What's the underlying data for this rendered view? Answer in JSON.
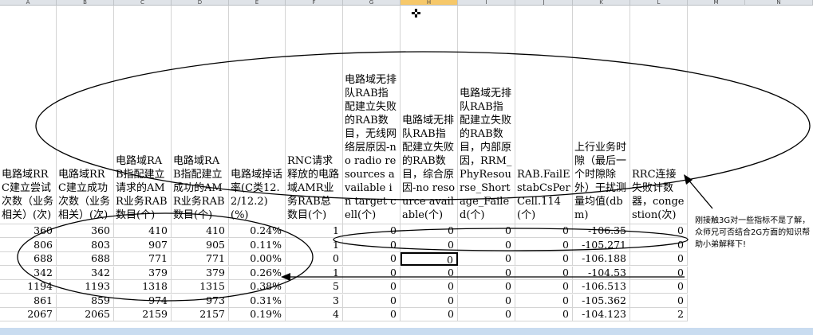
{
  "columns": [
    "A",
    "B",
    "C",
    "D",
    "E",
    "F",
    "G",
    "H",
    "I",
    "J",
    "K",
    "L",
    "M",
    "N"
  ],
  "selected_column": "H",
  "headers": [
    "电路域RRC建立尝试次数（业务相关）(次)",
    "电路域RRC建立成功次数（业务相关）(次)",
    "电路域RAB指配建立请求的AMR业务RAB数目(个)",
    "电路域RAB指配建立成功的AMR业务RAB数目(个)",
    "电路域掉话率(C类12.2/12.2)(%)",
    "RNC请求释放的电路域AMR业务RAB总数目(个)",
    "电路域无排队RAB指配建立失败的RAB数目，无线网络层原因-no radio resources available in target cell(个)",
    "电路域无排队RAB指配建立失败的RAB数目，综合原因-no resource available(个)",
    "电路域无排队RAB指配建立失败的RAB数目，内部原因，RRM_PhyResourse_Shortage_Failed(个)",
    "RAB.FailEstabCsPerCell.114(个)",
    "上行业务时隙（最后一个时隙除外）干扰测量均值(dbm)",
    "RRC连接失败计数器，congestion(次)"
  ],
  "rows": [
    [
      "360",
      "360",
      "410",
      "410",
      "0.24%",
      "1",
      "0",
      "0",
      "0",
      "0",
      "-106.35",
      "0"
    ],
    [
      "806",
      "803",
      "907",
      "905",
      "0.11%",
      "1",
      "0",
      "0",
      "0",
      "0",
      "-105.271",
      "0"
    ],
    [
      "688",
      "688",
      "771",
      "771",
      "0.00%",
      "0",
      "0",
      "0",
      "0",
      "0",
      "-106.188",
      "0"
    ],
    [
      "342",
      "342",
      "379",
      "379",
      "0.26%",
      "1",
      "0",
      "0",
      "0",
      "0",
      "-104.53",
      "0"
    ],
    [
      "1194",
      "1193",
      "1318",
      "1315",
      "0.38%",
      "5",
      "0",
      "0",
      "0",
      "0",
      "-106.513",
      "0"
    ],
    [
      "861",
      "859",
      "974",
      "973",
      "0.31%",
      "3",
      "0",
      "0",
      "0",
      "0",
      "-105.362",
      "0"
    ],
    [
      "2067",
      "2065",
      "2159",
      "2157",
      "0.19%",
      "4",
      "0",
      "0",
      "0",
      "0",
      "-104.123",
      "2"
    ]
  ],
  "active_cell": {
    "row": 2,
    "col": 7
  },
  "callout_text": "刚接触3G对一些指标不是了解，众师兄可否结合2G方面的知识帮助小弟解释下!",
  "colors": {
    "header_bg": "#dfe3e8",
    "selected_header": "#f6c86a",
    "grid": "#d4d4d4"
  }
}
